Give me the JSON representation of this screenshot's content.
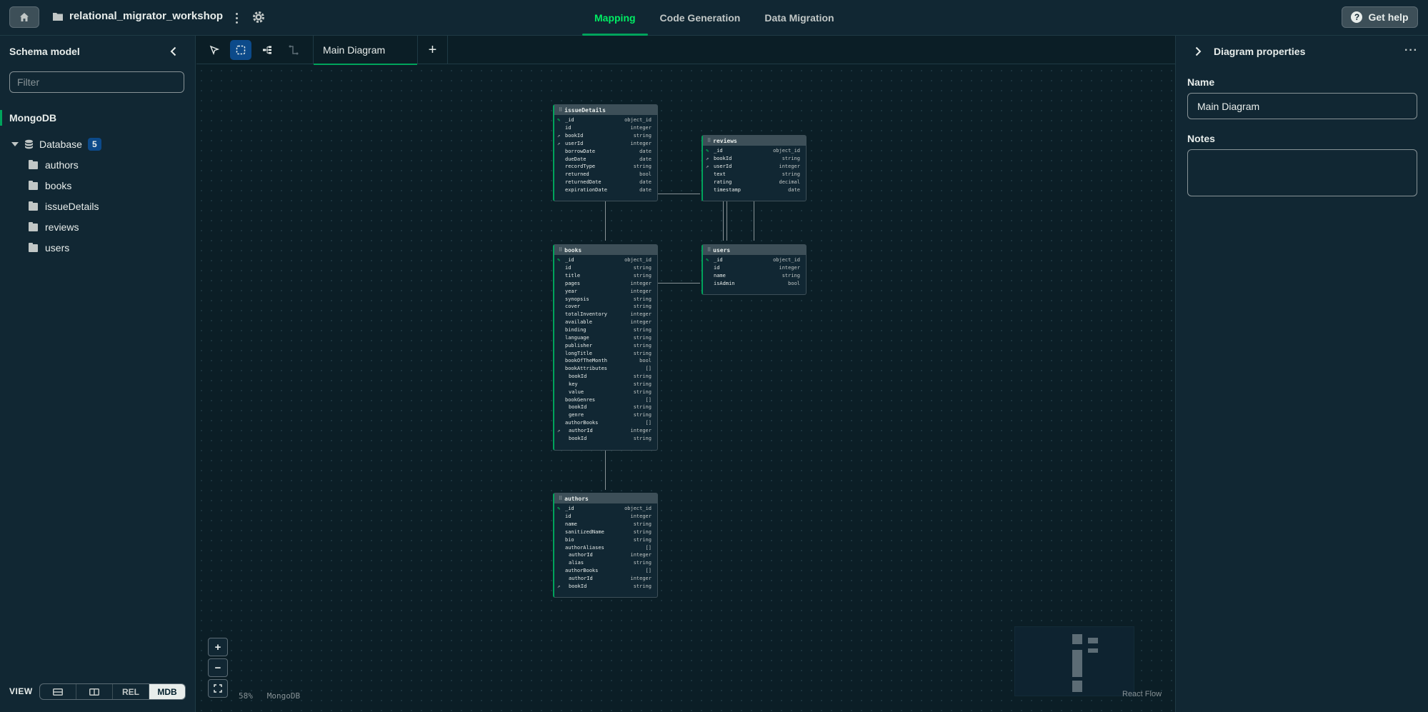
{
  "header": {
    "project_name": "relational_migrator_workshop",
    "tabs": [
      "Mapping",
      "Code Generation",
      "Data Migration"
    ],
    "active_tab": "Mapping",
    "help_label": "Get help",
    "accent": "#00ed64"
  },
  "sidebar": {
    "title": "Schema model",
    "filter_placeholder": "Filter",
    "source_label": "MongoDB",
    "database_label": "Database",
    "database_count": "5",
    "collections": [
      "authors",
      "books",
      "issueDetails",
      "reviews",
      "users"
    ],
    "view_label": "VIEW",
    "view_modes": [
      "REL",
      "MDB"
    ],
    "active_view": "MDB"
  },
  "canvas": {
    "diagram_tab": "Main Diagram",
    "zoom": "58%",
    "db_label": "MongoDB",
    "attribution": "React Flow",
    "entities": {
      "issueDetails": {
        "name": "issueDetails",
        "fields": [
          {
            "key": "pk",
            "name": "_id",
            "type": "object_id"
          },
          {
            "key": "",
            "name": "id",
            "type": "integer"
          },
          {
            "key": "fk",
            "name": "bookId",
            "type": "string"
          },
          {
            "key": "fk",
            "name": "userId",
            "type": "integer"
          },
          {
            "key": "",
            "name": "borrowDate",
            "type": "date"
          },
          {
            "key": "",
            "name": "dueDate",
            "type": "date"
          },
          {
            "key": "",
            "name": "recordType",
            "type": "string"
          },
          {
            "key": "",
            "name": "returned",
            "type": "bool"
          },
          {
            "key": "",
            "name": "returnedDate",
            "type": "date"
          },
          {
            "key": "",
            "name": "expirationDate",
            "type": "date"
          }
        ]
      },
      "reviews": {
        "name": "reviews",
        "fields": [
          {
            "key": "pk",
            "name": "_id",
            "type": "object_id"
          },
          {
            "key": "fk",
            "name": "bookId",
            "type": "string"
          },
          {
            "key": "fk",
            "name": "userId",
            "type": "integer"
          },
          {
            "key": "",
            "name": "text",
            "type": "string"
          },
          {
            "key": "",
            "name": "rating",
            "type": "decimal"
          },
          {
            "key": "",
            "name": "timestamp",
            "type": "date"
          }
        ]
      },
      "books": {
        "name": "books",
        "fields": [
          {
            "key": "pk",
            "name": "_id",
            "type": "object_id"
          },
          {
            "key": "",
            "name": "id",
            "type": "string"
          },
          {
            "key": "",
            "name": "title",
            "type": "string"
          },
          {
            "key": "",
            "name": "pages",
            "type": "integer"
          },
          {
            "key": "",
            "name": "year",
            "type": "integer"
          },
          {
            "key": "",
            "name": "synopsis",
            "type": "string"
          },
          {
            "key": "",
            "name": "cover",
            "type": "string"
          },
          {
            "key": "",
            "name": "totalInventory",
            "type": "integer"
          },
          {
            "key": "",
            "name": "available",
            "type": "integer"
          },
          {
            "key": "",
            "name": "binding",
            "type": "string"
          },
          {
            "key": "",
            "name": "language",
            "type": "string"
          },
          {
            "key": "",
            "name": "publisher",
            "type": "string"
          },
          {
            "key": "",
            "name": "longTitle",
            "type": "string"
          },
          {
            "key": "",
            "name": "bookOfTheMonth",
            "type": "bool"
          },
          {
            "key": "",
            "name": "bookAttributes",
            "type": "[]"
          },
          {
            "key": "",
            "name": "bookId",
            "type": "string",
            "nested": true
          },
          {
            "key": "",
            "name": "key",
            "type": "string",
            "nested": true
          },
          {
            "key": "",
            "name": "value",
            "type": "string",
            "nested": true
          },
          {
            "key": "",
            "name": "bookGenres",
            "type": "[]"
          },
          {
            "key": "",
            "name": "bookId",
            "type": "string",
            "nested": true
          },
          {
            "key": "",
            "name": "genre",
            "type": "string",
            "nested": true
          },
          {
            "key": "",
            "name": "authorBooks",
            "type": "[]"
          },
          {
            "key": "fk",
            "name": "authorId",
            "type": "integer",
            "nested": true
          },
          {
            "key": "",
            "name": "bookId",
            "type": "string",
            "nested": true
          }
        ]
      },
      "users": {
        "name": "users",
        "fields": [
          {
            "key": "pk",
            "name": "_id",
            "type": "object_id"
          },
          {
            "key": "",
            "name": "id",
            "type": "integer"
          },
          {
            "key": "",
            "name": "name",
            "type": "string"
          },
          {
            "key": "",
            "name": "isAdmin",
            "type": "bool"
          }
        ]
      },
      "authors": {
        "name": "authors",
        "fields": [
          {
            "key": "pk",
            "name": "_id",
            "type": "object_id"
          },
          {
            "key": "",
            "name": "id",
            "type": "integer"
          },
          {
            "key": "",
            "name": "name",
            "type": "string"
          },
          {
            "key": "",
            "name": "sanitizedName",
            "type": "string"
          },
          {
            "key": "",
            "name": "bio",
            "type": "string"
          },
          {
            "key": "",
            "name": "authorAliases",
            "type": "[]"
          },
          {
            "key": "",
            "name": "authorId",
            "type": "integer",
            "nested": true
          },
          {
            "key": "",
            "name": "alias",
            "type": "string",
            "nested": true
          },
          {
            "key": "",
            "name": "authorBooks",
            "type": "[]"
          },
          {
            "key": "",
            "name": "authorId",
            "type": "integer",
            "nested": true
          },
          {
            "key": "fk",
            "name": "bookId",
            "type": "string",
            "nested": true
          }
        ]
      }
    }
  },
  "properties": {
    "title": "Diagram properties",
    "name_label": "Name",
    "name_value": "Main Diagram",
    "notes_label": "Notes",
    "notes_value": ""
  }
}
